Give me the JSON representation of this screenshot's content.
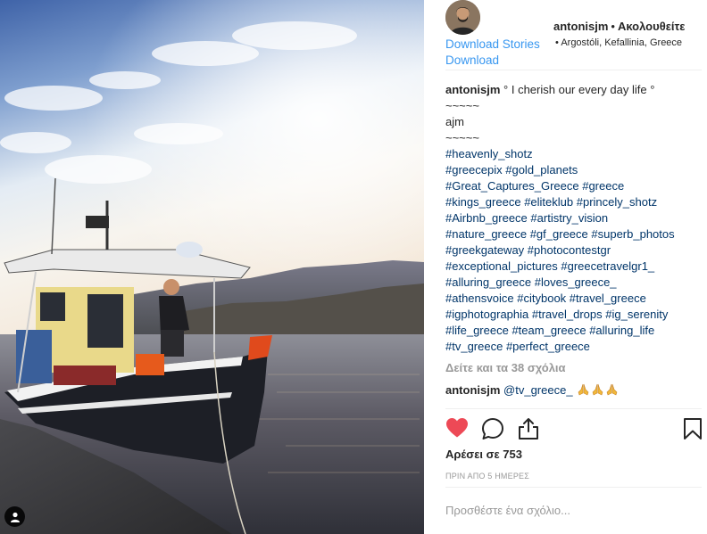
{
  "header": {
    "username": "antonisjm",
    "separator": "•",
    "follow_label": "Ακολουθείτε",
    "download_stories": "Download Stories",
    "download": "Download",
    "location_prefix": "•",
    "location": "Argostóli, Kefallinia, Greece"
  },
  "caption": {
    "username": "antonisjm",
    "text": "° I cherish our every day life °",
    "lines": [
      "~~~~~",
      "ajm",
      "~~~~~"
    ],
    "hashtag_lines": [
      [
        "#heavenly_shotz"
      ],
      [
        "#greecepix",
        "#gold_planets"
      ],
      [
        "#Great_Captures_Greece",
        "#greece"
      ],
      [
        "#kings_greece",
        "#eliteklub",
        "#princely_shotz"
      ],
      [
        "#Airbnb_greece",
        "#artistry_vision"
      ],
      [
        "#nature_greece",
        "#gf_greece",
        "#superb_photos"
      ],
      [
        "#greekgateway",
        "#photocontestgr"
      ],
      [
        "#exceptional_pictures",
        "#greecetravelgr1_"
      ],
      [
        "#alluring_greece",
        "#loves_greece_"
      ],
      [
        "#athensvoice",
        "#citybook",
        "#travel_greece"
      ],
      [
        "#igphotographia",
        "#travel_drops",
        "#ig_serenity"
      ],
      [
        "#life_greece",
        "#team_greece",
        "#alluring_life"
      ],
      [
        "#tv_greece",
        "#perfect_greece"
      ]
    ]
  },
  "view_comments": "Δείτε και τα 38 σχόλια",
  "comment": {
    "username": "antonisjm",
    "mention": "@tv_greece_",
    "emoji": "🙏🙏🙏"
  },
  "actions": {
    "like_icon": "heart-icon",
    "comment_icon": "comment-icon",
    "share_icon": "share-icon",
    "save_icon": "bookmark-icon",
    "like_color": "#ed4956"
  },
  "likes_text": "Αρέσει σε 753",
  "time_ago": "ΠΡΙΝ ΑΠΟ 5 ΗΜΕΡΕΣ",
  "add_comment_placeholder": "Προσθέστε ένα σχόλιο..."
}
